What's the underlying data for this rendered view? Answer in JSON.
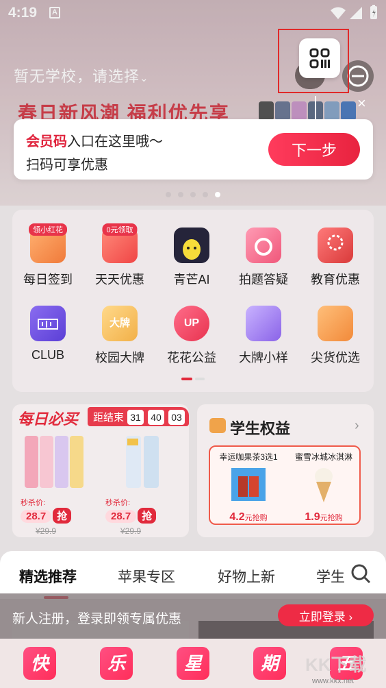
{
  "status": {
    "time": "4:19",
    "notif_icon": "A"
  },
  "header": {
    "school": "暂无学校，请选择",
    "school_chevron": "⌄",
    "promo": "春日新风潮 福利优先享"
  },
  "tip": {
    "emph": "会员码",
    "line1_rest": "入口在这里哦～",
    "line2": "扫码可享优惠",
    "next": "下一步",
    "close": "×"
  },
  "grid": {
    "row1": [
      {
        "label": "每日签到",
        "badge": "领小红花",
        "icon": "calendar-check-icon"
      },
      {
        "label": "天天优惠",
        "badge": "0元领取",
        "icon": "coupon-icon"
      },
      {
        "label": "青芒AI",
        "badge": "",
        "icon": "mango-ai-icon"
      },
      {
        "label": "拍题答疑",
        "badge": "",
        "icon": "camera-icon"
      },
      {
        "label": "教育优惠",
        "badge": "",
        "icon": "book-discount-icon"
      }
    ],
    "row2": [
      {
        "label": "CLUB",
        "icon": "club-card-icon"
      },
      {
        "label": "校园大牌",
        "badge_text": "大牌",
        "icon": "crown-icon"
      },
      {
        "label": "花花公益",
        "badge_text": "UP",
        "icon": "heart-icon"
      },
      {
        "label": "大牌小样",
        "icon": "gift-box-icon"
      },
      {
        "label": "尖货优选",
        "icon": "thumbs-up-bag-icon"
      }
    ]
  },
  "seckill": {
    "title": "每日必买",
    "ends_label": "距结束",
    "hh": "31",
    "mm": "40",
    "ss": "03",
    "products": [
      {
        "caption": "秒杀价:",
        "price": "28.7",
        "grab": "抢",
        "orig": "¥29.9"
      },
      {
        "caption": "秒杀价:",
        "price": "28.7",
        "grab": "抢",
        "orig": "¥29.9"
      }
    ]
  },
  "rights": {
    "title": "学生权益",
    "chevron": "›",
    "items": [
      {
        "name": "幸运咖果茶3选1",
        "price": "4.2",
        "suffix": "元抢购"
      },
      {
        "name": "蜜雪冰城冰淇淋",
        "price": "1.9",
        "suffix": "元抢购"
      }
    ]
  },
  "tabs": [
    "精选推荐",
    "苹果专区",
    "好物上新",
    "学生"
  ],
  "register": {
    "text": "新人注册，登录即领专属优惠",
    "button": "立即登录 ›"
  },
  "bottomnav": [
    "快",
    "乐",
    "星",
    "期",
    "五"
  ],
  "watermark": {
    "brand": "KK下载",
    "url": "www.kkx.net"
  },
  "colors": {
    "accent": "#e12a3c",
    "button": "#ff3b5c"
  }
}
